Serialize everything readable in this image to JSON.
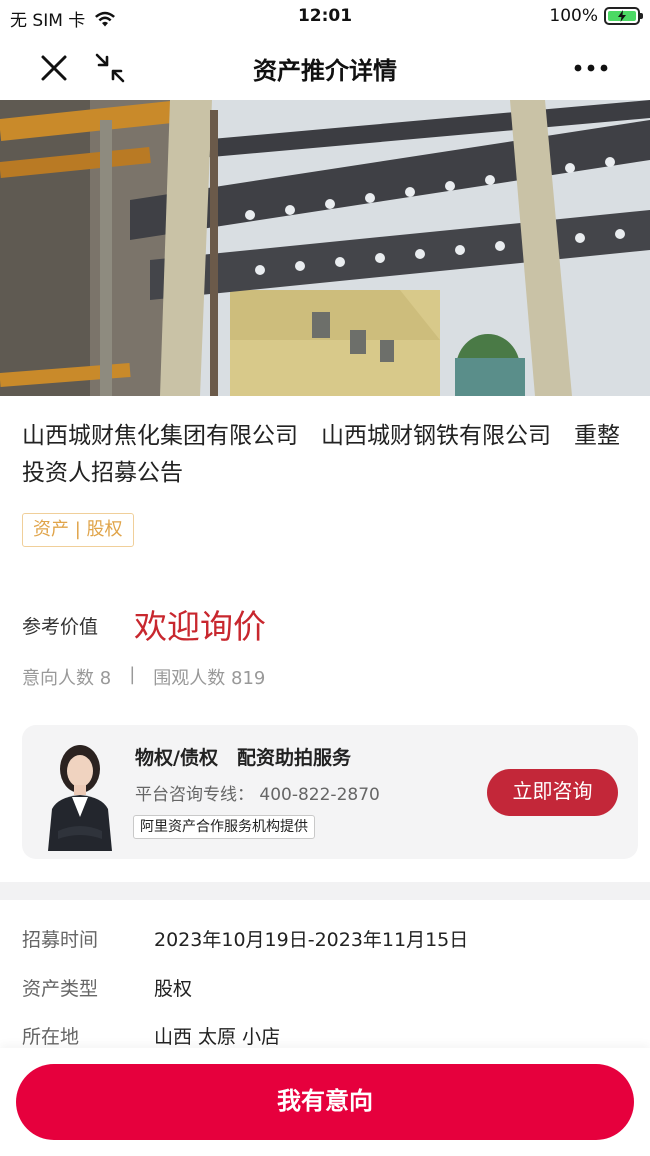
{
  "status_bar": {
    "carrier": "无 SIM 卡",
    "time": "12:01",
    "battery_percent": "100%"
  },
  "nav": {
    "title": "资产推介详情",
    "close_icon": "close-icon",
    "collapse_icon": "collapse-icon",
    "more_icon": "more-icon"
  },
  "listing": {
    "title": "山西城财焦化集团有限公司　山西城财钢铁有限公司　重整投资人招募公告",
    "tag": "资产 | 股权",
    "price_label": "参考价值",
    "price_value": "欢迎询价",
    "interested_label": "意向人数 8",
    "watchers_label": "围观人数 819",
    "separator": "|"
  },
  "service_card": {
    "title": "物权/债权　配资助拍服务",
    "phone": "平台咨询专线： 400-822-2870",
    "provider": "阿里资产合作服务机构提供",
    "button": "立即咨询"
  },
  "info": [
    {
      "key": "招募时间",
      "value": "2023年10月19日-2023年11月15日"
    },
    {
      "key": "资产类型",
      "value": "股权"
    },
    {
      "key": "所在地",
      "value": "山西 太原 小店"
    }
  ],
  "footer": {
    "cta": "我有意向"
  },
  "colors": {
    "accent_red": "#e6003d",
    "price_red": "#c8272e",
    "consult_button": "#c32739",
    "tag_orange": "#e0a44a"
  }
}
